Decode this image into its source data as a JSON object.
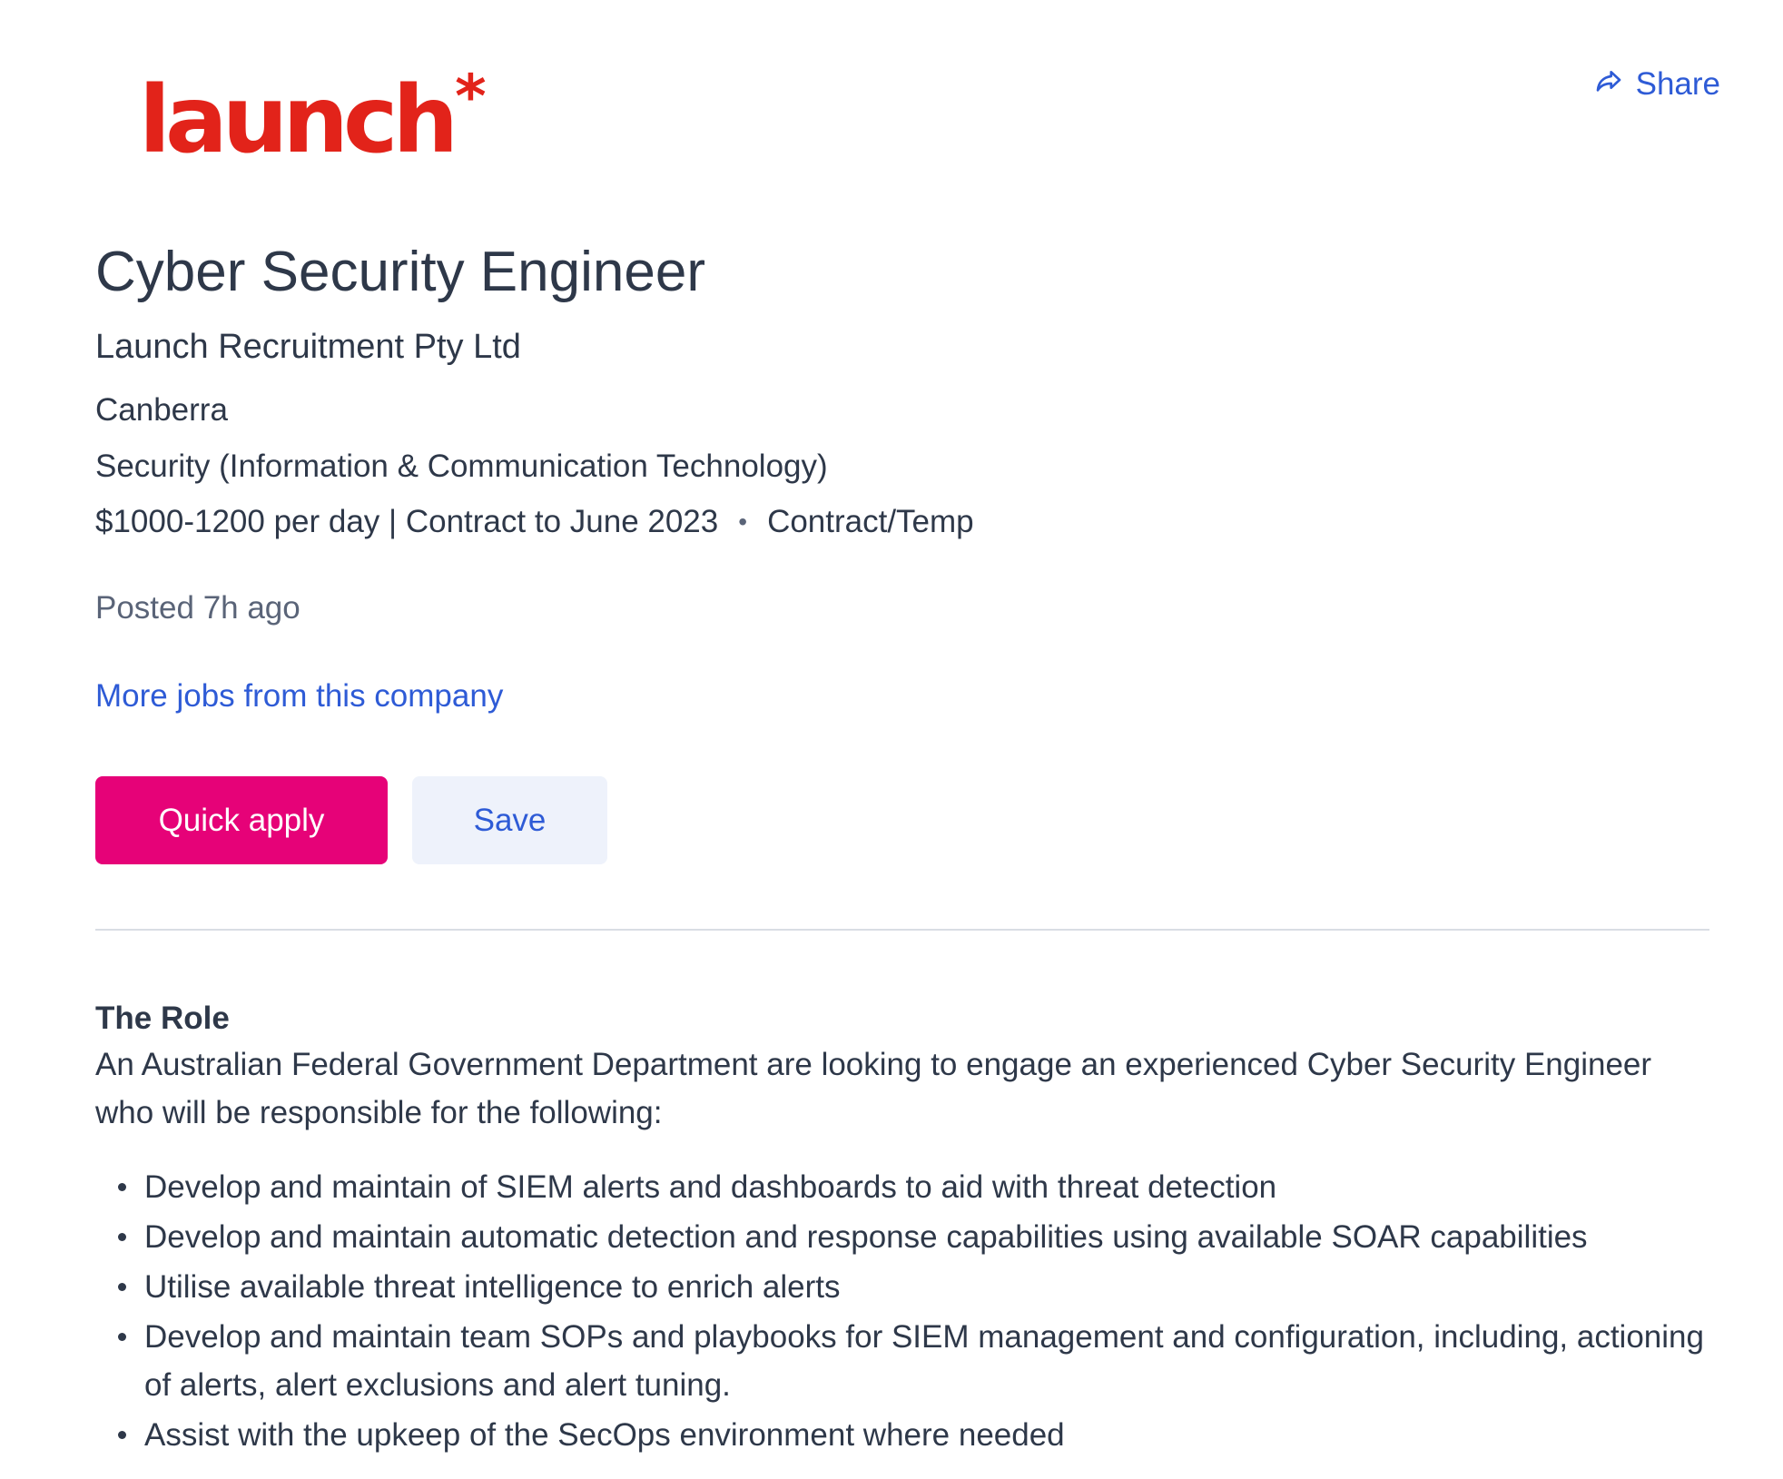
{
  "logo": {
    "text": "launch",
    "mark": "*",
    "color": "#e2231a"
  },
  "share": {
    "label": "Share",
    "icon": "share-arrow-icon"
  },
  "job": {
    "title": "Cyber Security Engineer",
    "company": "Launch Recruitment Pty Ltd",
    "location": "Canberra",
    "category": "Security (Information & Communication Technology)",
    "salary": "$1000-1200 per day | Contract to June 2023",
    "separator": "•",
    "work_type": "Contract/Temp",
    "posted": "Posted 7h ago",
    "more_jobs_link": "More jobs from this company"
  },
  "actions": {
    "quick_apply": "Quick apply",
    "save": "Save"
  },
  "description": {
    "heading": "The Role",
    "intro": "An Australian Federal Government Department are looking to engage an experienced Cyber Security Engineer who will be responsible for the following:",
    "bullets": [
      "Develop and maintain of SIEM alerts and dashboards to aid with threat detection",
      "Develop and maintain automatic detection and response capabilities using available SOAR capabilities",
      "Utilise available threat intelligence to enrich alerts",
      "Develop and maintain team SOPs and playbooks for SIEM management and configuration, including, actioning of alerts, alert exclusions and alert tuning.",
      "Assist with the upkeep of the SecOps environment where needed"
    ]
  },
  "colors": {
    "text": "#2e3849",
    "muted": "#5a6478",
    "link": "#2e5bd6",
    "primary_button": "#e60278",
    "secondary_button_bg": "#eef2fb",
    "divider": "#d9dde4"
  }
}
